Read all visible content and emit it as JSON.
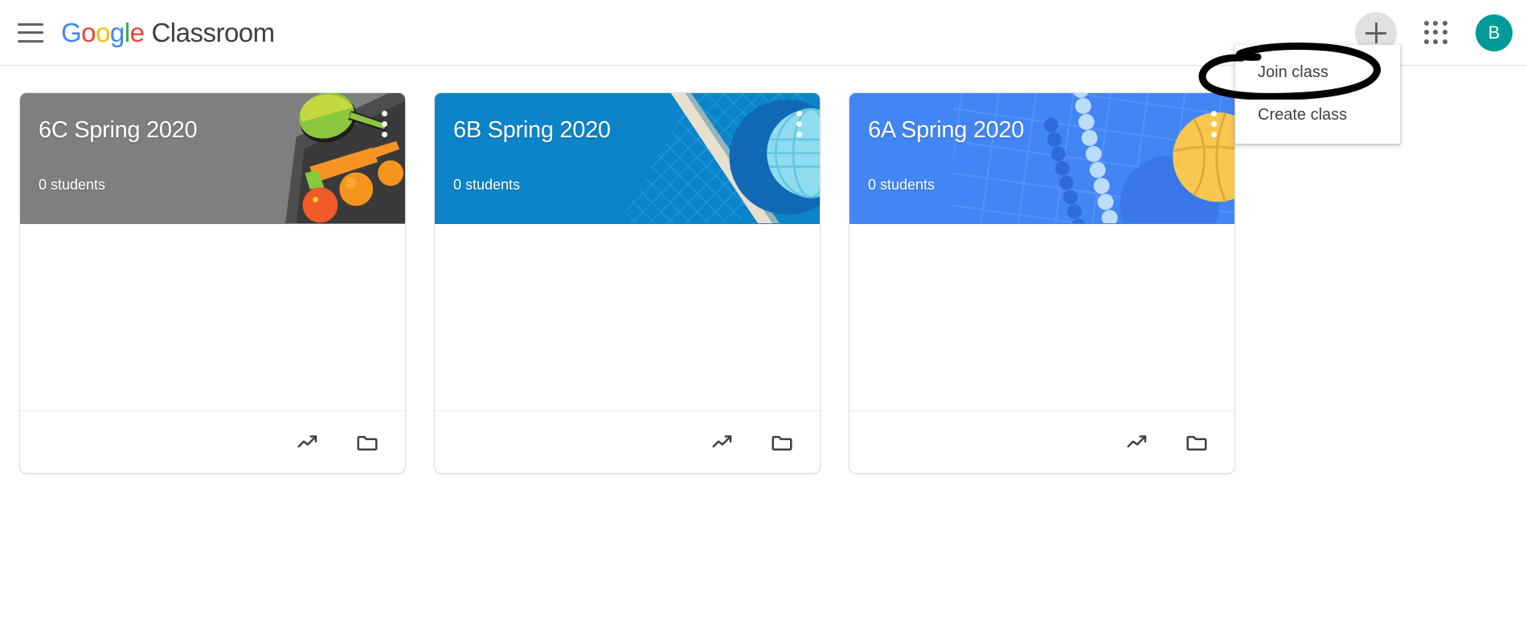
{
  "header": {
    "menu_icon": "hamburger-menu-icon",
    "brand": {
      "google": [
        "G",
        "o",
        "o",
        "g",
        "l",
        "e"
      ],
      "product": "Classroom"
    },
    "add_button_label": "+",
    "apps_icon": "apps-grid-icon",
    "avatar_initial": "B"
  },
  "dropdown": {
    "items": [
      {
        "label": "Join class"
      },
      {
        "label": "Create class"
      }
    ],
    "highlighted": "Join class"
  },
  "cards": [
    {
      "title": "6C Spring 2020",
      "students": "0 students",
      "theme_color": "#7f7f7f",
      "art": "ping-pong-paddle",
      "kebab": "more-options-icon",
      "footer": [
        {
          "icon": "trending-up-icon"
        },
        {
          "icon": "folder-icon"
        }
      ]
    },
    {
      "title": "6B Spring 2020",
      "students": "0 students",
      "theme_color": "#0b84c9",
      "art": "tennis-racket-net",
      "kebab": "more-options-icon",
      "footer": [
        {
          "icon": "trending-up-icon"
        },
        {
          "icon": "folder-icon"
        }
      ]
    },
    {
      "title": "6A Spring 2020",
      "students": "0 students",
      "theme_color": "#4285f4",
      "art": "volleyball-net",
      "kebab": "more-options-icon",
      "footer": [
        {
          "icon": "trending-up-icon"
        },
        {
          "icon": "folder-icon"
        }
      ]
    }
  ],
  "colors": {
    "google_blue": "#4285f4",
    "google_red": "#ea4335",
    "google_yellow": "#fbbc05",
    "google_green": "#34a853",
    "avatar_teal": "#009a9a",
    "annotation_black": "#000000"
  }
}
